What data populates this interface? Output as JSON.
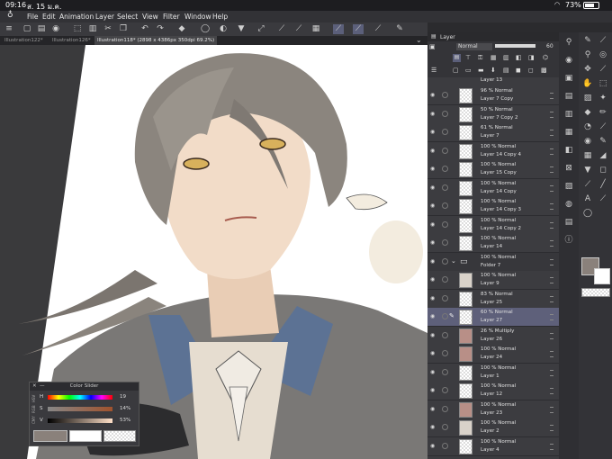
{
  "status": {
    "time": "09:16",
    "date": "ส. 15 ม.ค.",
    "battery": "73%"
  },
  "menu": [
    "File",
    "Edit",
    "Animation",
    "Layer",
    "Select",
    "View",
    "Filter",
    "Window",
    "Help"
  ],
  "tabs": [
    "Illustration122*",
    "Illustration126*",
    "Illustration118* (2898 x 4386px 350dpi 69.2%)"
  ],
  "layer_panel": {
    "title": "Layer",
    "blend_mode": "Normal",
    "opacity": "60",
    "top_partial_layer": "Layer 13",
    "layers": [
      {
        "mode": "96 % Normal",
        "name": "Layer 7 Copy",
        "thumb": "checker"
      },
      {
        "mode": "50 % Normal",
        "name": "Layer 7 Copy 2",
        "thumb": "checker"
      },
      {
        "mode": "61 % Normal",
        "name": "Layer 7",
        "thumb": "checker"
      },
      {
        "mode": "100 % Normal",
        "name": "Layer 14 Copy 4",
        "thumb": "checker"
      },
      {
        "mode": "100 % Normal",
        "name": "Layer 15 Copy",
        "thumb": "checker"
      },
      {
        "mode": "100 % Normal",
        "name": "Layer 14 Copy",
        "thumb": "checker"
      },
      {
        "mode": "100 % Normal",
        "name": "Layer 14 Copy 3",
        "thumb": "checker"
      },
      {
        "mode": "100 % Normal",
        "name": "Layer 14 Copy 2",
        "thumb": "checker"
      },
      {
        "mode": "100 % Normal",
        "name": "Layer 14",
        "thumb": "checker"
      },
      {
        "mode": "100 % Normal",
        "name": "Folder 7",
        "thumb": "folder"
      },
      {
        "mode": "100 % Normal",
        "name": "Layer 9",
        "thumb": "art"
      },
      {
        "mode": "83 % Normal",
        "name": "Layer 25",
        "thumb": "checker"
      },
      {
        "mode": "60 % Normal",
        "name": "Layer 27",
        "thumb": "checker",
        "selected": true
      },
      {
        "mode": "26 % Multiply",
        "name": "Layer 26",
        "thumb": "art2"
      },
      {
        "mode": "100 % Normal",
        "name": "Layer 24",
        "thumb": "art2"
      },
      {
        "mode": "100 % Normal",
        "name": "Layer 1",
        "thumb": "checker"
      },
      {
        "mode": "100 % Normal",
        "name": "Layer 12",
        "thumb": "checker"
      },
      {
        "mode": "100 % Normal",
        "name": "Layer 23",
        "thumb": "art2"
      },
      {
        "mode": "100 % Normal",
        "name": "Layer 2",
        "thumb": "art"
      },
      {
        "mode": "100 % Normal",
        "name": "Layer 4",
        "thumb": "checker"
      }
    ]
  },
  "color_slider": {
    "title": "Color Slider",
    "tabs": [
      "HSV",
      "RGB",
      "CMY"
    ],
    "h_label": "H",
    "h_value": "19",
    "s_label": "S",
    "s_value": "14%",
    "v_label": "V",
    "v_value": "53%",
    "colors": {
      "main": "#8a817b",
      "sub": "#ffffff"
    }
  },
  "colors": {
    "accent": "#5e607a",
    "main_color_swatch": "#8a817b"
  }
}
